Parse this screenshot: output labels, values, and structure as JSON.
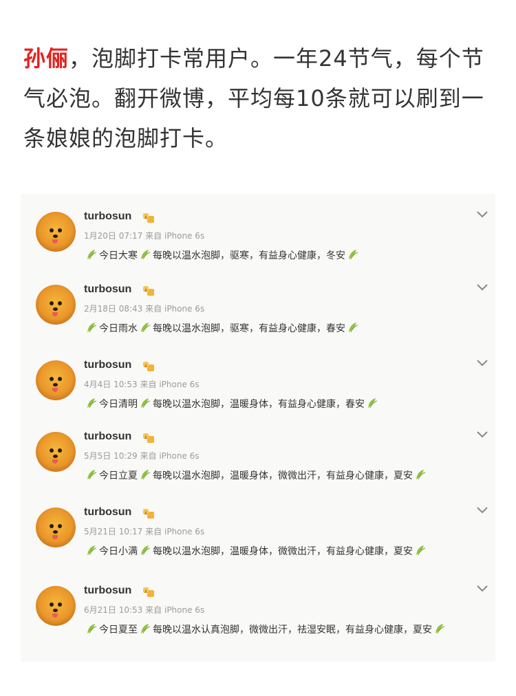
{
  "intro": {
    "name": "孙俪",
    "text": "，泡脚打卡常用户。一年24节气，每个节气必泡。翻开微博，平均每10条就可以刷到一条娘娘的泡脚打卡。"
  },
  "feed": {
    "posts": [
      {
        "username": "turbosun",
        "date": "1月20日 07:17",
        "source_prefix": "来自",
        "device": "iPhone 6s",
        "term": "今日大寒",
        "body": "每晚以温水泡脚，驱寒，有益身心健康，冬安",
        "tail": ""
      },
      {
        "username": "turbosun",
        "date": "2月18日 08:43",
        "source_prefix": "来自",
        "device": "iPhone 6s",
        "term": "今日雨水",
        "body": "每晚以温水泡脚，驱寒，有益身心健康，春安",
        "tail": ""
      },
      {
        "username": "turbosun",
        "date": "4月4日 10:53",
        "source_prefix": "来自",
        "device": "iPhone 6s",
        "term": "今日清明",
        "body": "每晚以温水泡脚，温暖身体，有益身心健康，春安",
        "tail": ""
      },
      {
        "username": "turbosun",
        "date": "5月5日 10:29",
        "source_prefix": "来自",
        "device": "iPhone 6s",
        "term": "今日立夏",
        "body": "每晚以温水泡脚，温暖身体，微微出汗，有益身心健康，夏安",
        "tail": ""
      },
      {
        "username": "turbosun",
        "date": "5月21日 10:17",
        "source_prefix": "来自",
        "device": "iPhone 6s",
        "term": "今日小满",
        "body": "每晚以温水泡脚，温暖身体，微微出汗，有益身心健康，夏安",
        "tail": ""
      },
      {
        "username": "turbosun",
        "date": "6月21日 10:53",
        "source_prefix": "来自",
        "device": "iPhone 6s",
        "term": "今日夏至",
        "body": "每晚以温水认真泡脚，微微出汗，祛湿安眠，有益身心健康，夏",
        "tail": "安"
      }
    ]
  },
  "colors": {
    "name_red": "#e5211d",
    "text": "#333333",
    "meta_gray": "#9a9a9a",
    "leaf_green": "#8fc23f",
    "feed_bg": "#f9f9f7"
  },
  "icons": {
    "leaf": "leaf-icon",
    "badge": "vip-badge-icon",
    "chevron": "chevron-down-icon"
  }
}
